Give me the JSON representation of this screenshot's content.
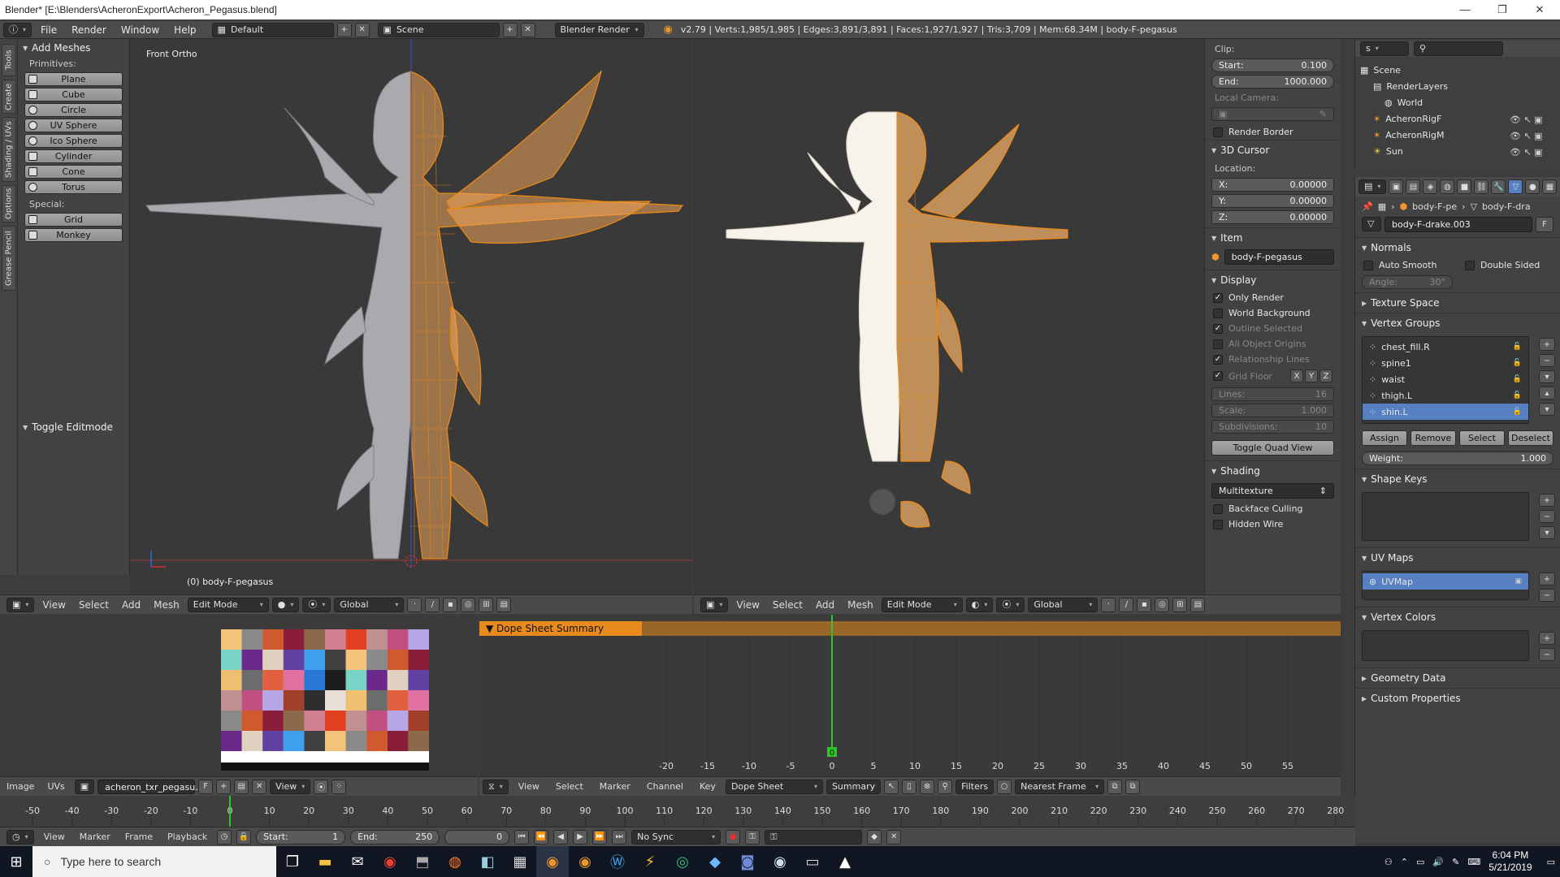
{
  "window": {
    "title": "Blender* [E:\\Blenders\\AcheronExport\\Acheron_Pegasus.blend]",
    "minimize": "—",
    "maximize": "❐",
    "close": "✕"
  },
  "info": {
    "menus": [
      "File",
      "Render",
      "Window",
      "Help"
    ],
    "layout": "Default",
    "scene": "Scene",
    "engine": "Blender Render",
    "stats": "v2.79 | Verts:1,985/1,985 | Edges:3,891/3,891 | Faces:1,927/1,927 | Tris:3,709 | Mem:68.34M | body-F-pegasus"
  },
  "tooltabs": [
    "Tools",
    "Create",
    "Shading / UVs",
    "Options",
    "Grease Pencil"
  ],
  "toolshelf": {
    "title": "Add Meshes",
    "primitives_label": "Primitives:",
    "primitives": [
      "Plane",
      "Cube",
      "Circle",
      "UV Sphere",
      "Ico Sphere",
      "Cylinder",
      "Cone",
      "Torus"
    ],
    "special_label": "Special:",
    "special": [
      "Grid",
      "Monkey"
    ],
    "toggle_editmode": "Toggle Editmode"
  },
  "viewport_left": {
    "label": "Front Ortho",
    "object_label": "(0) body-F-pegasus",
    "menus": [
      "View",
      "Select",
      "Add",
      "Mesh"
    ],
    "mode": "Edit Mode",
    "orientation": "Global"
  },
  "viewport_right": {
    "menus": [
      "View",
      "Select",
      "Add",
      "Mesh"
    ],
    "mode": "Edit Mode",
    "orientation": "Global"
  },
  "npanel": {
    "clip_label": "Clip:",
    "clip_start_label": "Start:",
    "clip_start": "0.100",
    "clip_end_label": "End:",
    "clip_end": "1000.000",
    "local_camera": "Local Camera:",
    "render_border": "Render Border",
    "cursor_title": "3D Cursor",
    "location_label": "Location:",
    "x_label": "X:",
    "x": "0.00000",
    "y_label": "Y:",
    "y": "0.00000",
    "z_label": "Z:",
    "z": "0.00000",
    "item_title": "Item",
    "item_name": "body-F-pegasus",
    "display_title": "Display",
    "only_render": "Only Render",
    "world_background": "World Background",
    "outline_selected": "Outline Selected",
    "all_object_origins": "All Object Origins",
    "relationship_lines": "Relationship Lines",
    "grid_floor": "Grid Floor",
    "axes": [
      "X",
      "Y",
      "Z"
    ],
    "lines_label": "Lines:",
    "lines": "16",
    "scale_label": "Scale:",
    "scale": "1.000",
    "subdiv_label": "Subdivisions:",
    "subdiv": "10",
    "toggle_quad": "Toggle Quad View",
    "shading_title": "Shading",
    "shading_mode": "Multitexture",
    "backface": "Backface Culling",
    "hidden_wire": "Hidden Wire"
  },
  "outliner": {
    "items": [
      "Scene",
      "RenderLayers",
      "World",
      "AcheronRigF",
      "AcheronRigM",
      "Sun"
    ]
  },
  "props": {
    "breadcrumb1": "body-F-pe",
    "breadcrumb2": "body-F-dra",
    "mesh_name": "body-F-drake.003",
    "fake_user": "F",
    "normals": "Normals",
    "auto_smooth": "Auto Smooth",
    "double_sided": "Double Sided",
    "angle_label": "Angle:",
    "angle": "30°",
    "texture_space": "Texture Space",
    "vertex_groups": "Vertex Groups",
    "vgroups": [
      "chest_fill.R",
      "spine1",
      "waist",
      "thigh.L",
      "shin.L"
    ],
    "assign": "Assign",
    "remove": "Remove",
    "select": "Select",
    "deselect": "Deselect",
    "weight_label": "Weight:",
    "weight": "1.000",
    "shape_keys": "Shape Keys",
    "uv_maps": "UV Maps",
    "uvmap": "UVMap",
    "vertex_colors": "Vertex Colors",
    "geometry_data": "Geometry Data",
    "custom_properties": "Custom Properties"
  },
  "uv_editor": {
    "tabs": [
      "Image",
      "UVs"
    ],
    "image_name": "acheron_txr_pegasu...",
    "fake": "F",
    "view": "View"
  },
  "dopesheet": {
    "summary_channel": "Dope Sheet Summary",
    "current_frame": "0",
    "ruler": [
      "-20",
      "-15",
      "-10",
      "-5",
      "0",
      "5",
      "10",
      "15",
      "20",
      "25",
      "30",
      "35",
      "40",
      "45",
      "50",
      "55"
    ],
    "menus": [
      "View",
      "Select",
      "Marker",
      "Channel",
      "Key"
    ],
    "mode": "Dope Sheet",
    "summary": "Summary",
    "filters": "Filters",
    "snap": "Nearest Frame"
  },
  "timeline": {
    "ruler": [
      "-50",
      "-40",
      "-30",
      "-20",
      "-10",
      "0",
      "10",
      "20",
      "30",
      "40",
      "50",
      "60",
      "70",
      "80",
      "90",
      "100",
      "110",
      "120",
      "130",
      "140",
      "150",
      "160",
      "170",
      "180",
      "190",
      "200",
      "210",
      "220",
      "230",
      "240",
      "250",
      "260",
      "270",
      "280"
    ],
    "menus": [
      "View",
      "Marker",
      "Frame",
      "Playback"
    ],
    "start_label": "Start:",
    "start": "1",
    "end_label": "End:",
    "end": "250",
    "frame": "0",
    "sync": "No Sync"
  },
  "taskbar": {
    "search_placeholder": "Type here to search",
    "time": "6:04 PM",
    "date": "5/21/2019"
  },
  "colors": {
    "accent_orange": "#f0962a",
    "selection_blue": "#5680c2",
    "playhead_green": "#2ec52e"
  }
}
